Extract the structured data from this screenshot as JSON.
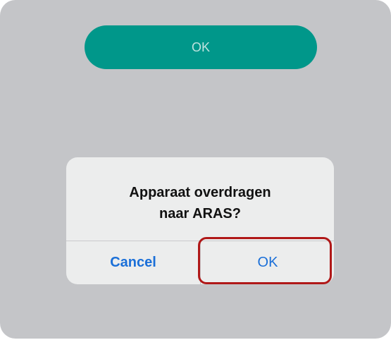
{
  "top_button": {
    "label": "OK"
  },
  "alert": {
    "title_line1": "Apparaat overdragen",
    "title_line2": "naar ARAS?",
    "cancel_label": "Cancel",
    "ok_label": "OK"
  },
  "colors": {
    "backdrop": "#c4c5c8",
    "top_button_bg": "#00978a",
    "alert_bg": "#eceded",
    "alert_button_text": "#1a6fd8",
    "highlight_border": "#b01818"
  }
}
